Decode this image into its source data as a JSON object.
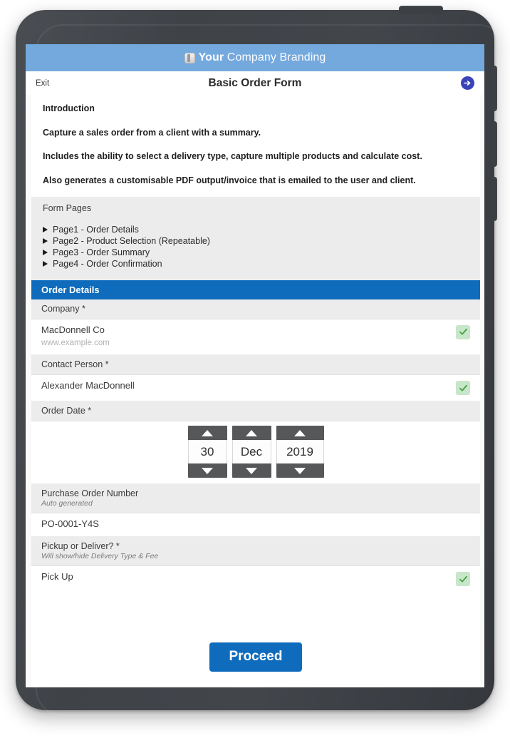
{
  "device": {
    "type": "tablet",
    "frame_color": "#42464b",
    "buttons": [
      "power-button",
      "volume-up-button",
      "volume-down-button",
      "volume-extra-button"
    ]
  },
  "brand_bar": {
    "logo_icon": "book-logo-icon",
    "strong_text": "Your",
    "light_text": " Company Branding",
    "background": "#74a9de"
  },
  "title_bar": {
    "exit_label": "Exit",
    "title": "Basic Order Form",
    "next_icon": "arrow-right-circle-icon",
    "next_icon_color": "#3a43b8"
  },
  "intro": {
    "paragraphs": [
      "Introduction",
      "Capture a sales order from a client with a summary.",
      "Includes the ability to select a delivery type, capture multiple products and calculate cost.",
      "Also generates a customisable PDF output/invoice that is emailed to the user and client."
    ]
  },
  "form_pages": {
    "title": "Form Pages",
    "items": [
      {
        "label": "Page1 - Order Details",
        "icon": "triangle-right-icon"
      },
      {
        "label": "Page2 - Product Selection (Repeatable)",
        "icon": "triangle-right-icon"
      },
      {
        "label": "Page3 - Order Summary",
        "icon": "triangle-right-icon"
      },
      {
        "label": "Page4 - Order Confirmation",
        "icon": "triangle-right-icon"
      }
    ]
  },
  "section": {
    "header": "Order Details",
    "header_color": "#0f6cbd"
  },
  "fields": {
    "company": {
      "label": "Company *",
      "value": "MacDonnell Co",
      "sub_value": "www.example.com",
      "valid": true,
      "valid_icon": "check-icon",
      "valid_color": "#4caf50"
    },
    "contact_person": {
      "label": "Contact Person *",
      "value": "Alexander MacDonnell",
      "valid": true,
      "valid_icon": "check-icon"
    },
    "order_date": {
      "label": "Order Date *",
      "day": "30",
      "month": "Dec",
      "year": "2019",
      "up_icon": "triangle-up-icon",
      "down_icon": "triangle-down-icon"
    },
    "purchase_order": {
      "label": "Purchase Order Number",
      "hint": "Auto generated",
      "value": "PO-0001-Y4S"
    },
    "pickup_or_deliver": {
      "label": "Pickup or Deliver? *",
      "hint": "Will show/hide Delivery Type & Fee",
      "value": "Pick Up",
      "valid": true,
      "valid_icon": "check-icon"
    }
  },
  "actions": {
    "proceed_label": "Proceed",
    "proceed_color": "#0f6cbd"
  }
}
